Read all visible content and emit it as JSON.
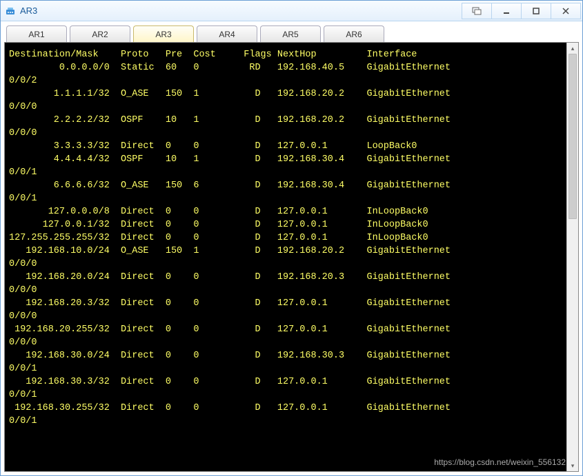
{
  "window": {
    "title": "AR3"
  },
  "tabs": [
    "AR1",
    "AR2",
    "AR3",
    "AR4",
    "AR5",
    "AR6"
  ],
  "active_tab": "AR3",
  "headers": {
    "dest": "Destination/Mask",
    "proto": "Proto",
    "pre": "Pre",
    "cost": "Cost",
    "flags": "Flags",
    "nexthop": "NextHop",
    "iface": "Interface"
  },
  "routes": [
    {
      "dest": "0.0.0.0/0",
      "proto": "Static",
      "pre": "60",
      "cost": "0",
      "flags": "RD",
      "nexthop": "192.168.40.5",
      "iface": "GigabitEthernet",
      "wrap": "0/0/2"
    },
    {
      "dest": "1.1.1.1/32",
      "proto": "O_ASE",
      "pre": "150",
      "cost": "1",
      "flags": "D",
      "nexthop": "192.168.20.2",
      "iface": "GigabitEthernet",
      "wrap": "0/0/0"
    },
    {
      "dest": "2.2.2.2/32",
      "proto": "OSPF",
      "pre": "10",
      "cost": "1",
      "flags": "D",
      "nexthop": "192.168.20.2",
      "iface": "GigabitEthernet",
      "wrap": "0/0/0"
    },
    {
      "dest": "3.3.3.3/32",
      "proto": "Direct",
      "pre": "0",
      "cost": "0",
      "flags": "D",
      "nexthop": "127.0.0.1",
      "iface": "LoopBack0",
      "wrap": null
    },
    {
      "dest": "4.4.4.4/32",
      "proto": "OSPF",
      "pre": "10",
      "cost": "1",
      "flags": "D",
      "nexthop": "192.168.30.4",
      "iface": "GigabitEthernet",
      "wrap": "0/0/1"
    },
    {
      "dest": "6.6.6.6/32",
      "proto": "O_ASE",
      "pre": "150",
      "cost": "6",
      "flags": "D",
      "nexthop": "192.168.30.4",
      "iface": "GigabitEthernet",
      "wrap": "0/0/1"
    },
    {
      "dest": "127.0.0.0/8",
      "proto": "Direct",
      "pre": "0",
      "cost": "0",
      "flags": "D",
      "nexthop": "127.0.0.1",
      "iface": "InLoopBack0",
      "wrap": null
    },
    {
      "dest": "127.0.0.1/32",
      "proto": "Direct",
      "pre": "0",
      "cost": "0",
      "flags": "D",
      "nexthop": "127.0.0.1",
      "iface": "InLoopBack0",
      "wrap": null
    },
    {
      "dest": "127.255.255.255/32",
      "proto": "Direct",
      "pre": "0",
      "cost": "0",
      "flags": "D",
      "nexthop": "127.0.0.1",
      "iface": "InLoopBack0",
      "wrap": null
    },
    {
      "dest": "192.168.10.0/24",
      "proto": "O_ASE",
      "pre": "150",
      "cost": "1",
      "flags": "D",
      "nexthop": "192.168.20.2",
      "iface": "GigabitEthernet",
      "wrap": "0/0/0"
    },
    {
      "dest": "192.168.20.0/24",
      "proto": "Direct",
      "pre": "0",
      "cost": "0",
      "flags": "D",
      "nexthop": "192.168.20.3",
      "iface": "GigabitEthernet",
      "wrap": "0/0/0"
    },
    {
      "dest": "192.168.20.3/32",
      "proto": "Direct",
      "pre": "0",
      "cost": "0",
      "flags": "D",
      "nexthop": "127.0.0.1",
      "iface": "GigabitEthernet",
      "wrap": "0/0/0"
    },
    {
      "dest": "192.168.20.255/32",
      "proto": "Direct",
      "pre": "0",
      "cost": "0",
      "flags": "D",
      "nexthop": "127.0.0.1",
      "iface": "GigabitEthernet",
      "wrap": "0/0/0"
    },
    {
      "dest": "192.168.30.0/24",
      "proto": "Direct",
      "pre": "0",
      "cost": "0",
      "flags": "D",
      "nexthop": "192.168.30.3",
      "iface": "GigabitEthernet",
      "wrap": "0/0/1"
    },
    {
      "dest": "192.168.30.3/32",
      "proto": "Direct",
      "pre": "0",
      "cost": "0",
      "flags": "D",
      "nexthop": "127.0.0.1",
      "iface": "GigabitEthernet",
      "wrap": "0/0/1"
    },
    {
      "dest": "192.168.30.255/32",
      "proto": "Direct",
      "pre": "0",
      "cost": "0",
      "flags": "D",
      "nexthop": "127.0.0.1",
      "iface": "GigabitEthernet",
      "wrap": "0/0/1"
    }
  ],
  "watermark": "https://blog.csdn.net/weixin_556132"
}
